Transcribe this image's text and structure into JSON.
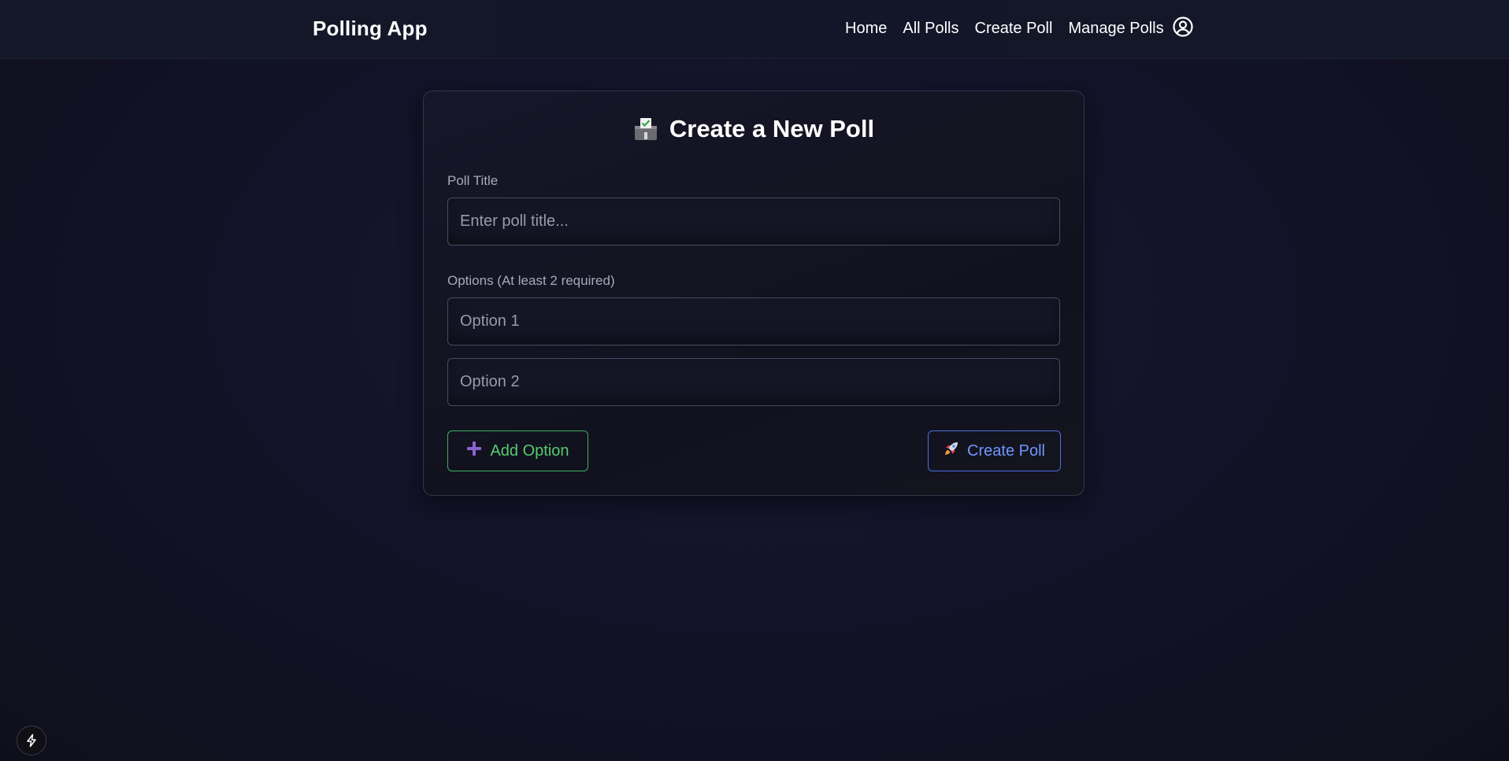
{
  "nav": {
    "brand": "Polling App",
    "links": [
      {
        "label": "Home"
      },
      {
        "label": "All Polls"
      },
      {
        "label": "Create Poll"
      },
      {
        "label": "Manage Polls"
      }
    ],
    "user_icon": "user-circle-icon"
  },
  "form": {
    "title": "Create a New Poll",
    "title_icon": "ballot-box-icon",
    "poll_title_label": "Poll Title",
    "poll_title_placeholder": "Enter poll title...",
    "poll_title_value": "",
    "options_label": "Options (At least 2 required)",
    "options": [
      {
        "placeholder": "Option 1",
        "value": ""
      },
      {
        "placeholder": "Option 2",
        "value": ""
      }
    ],
    "add_option_label": "Add Option",
    "add_option_icon": "plus-icon",
    "create_poll_label": "Create Poll",
    "create_poll_icon": "rocket-icon"
  },
  "colors": {
    "add_button": "#55cc6f",
    "create_button": "#6f96ff",
    "plus_icon": "#8a63d2"
  },
  "floating_button_icon": "lightning-icon"
}
